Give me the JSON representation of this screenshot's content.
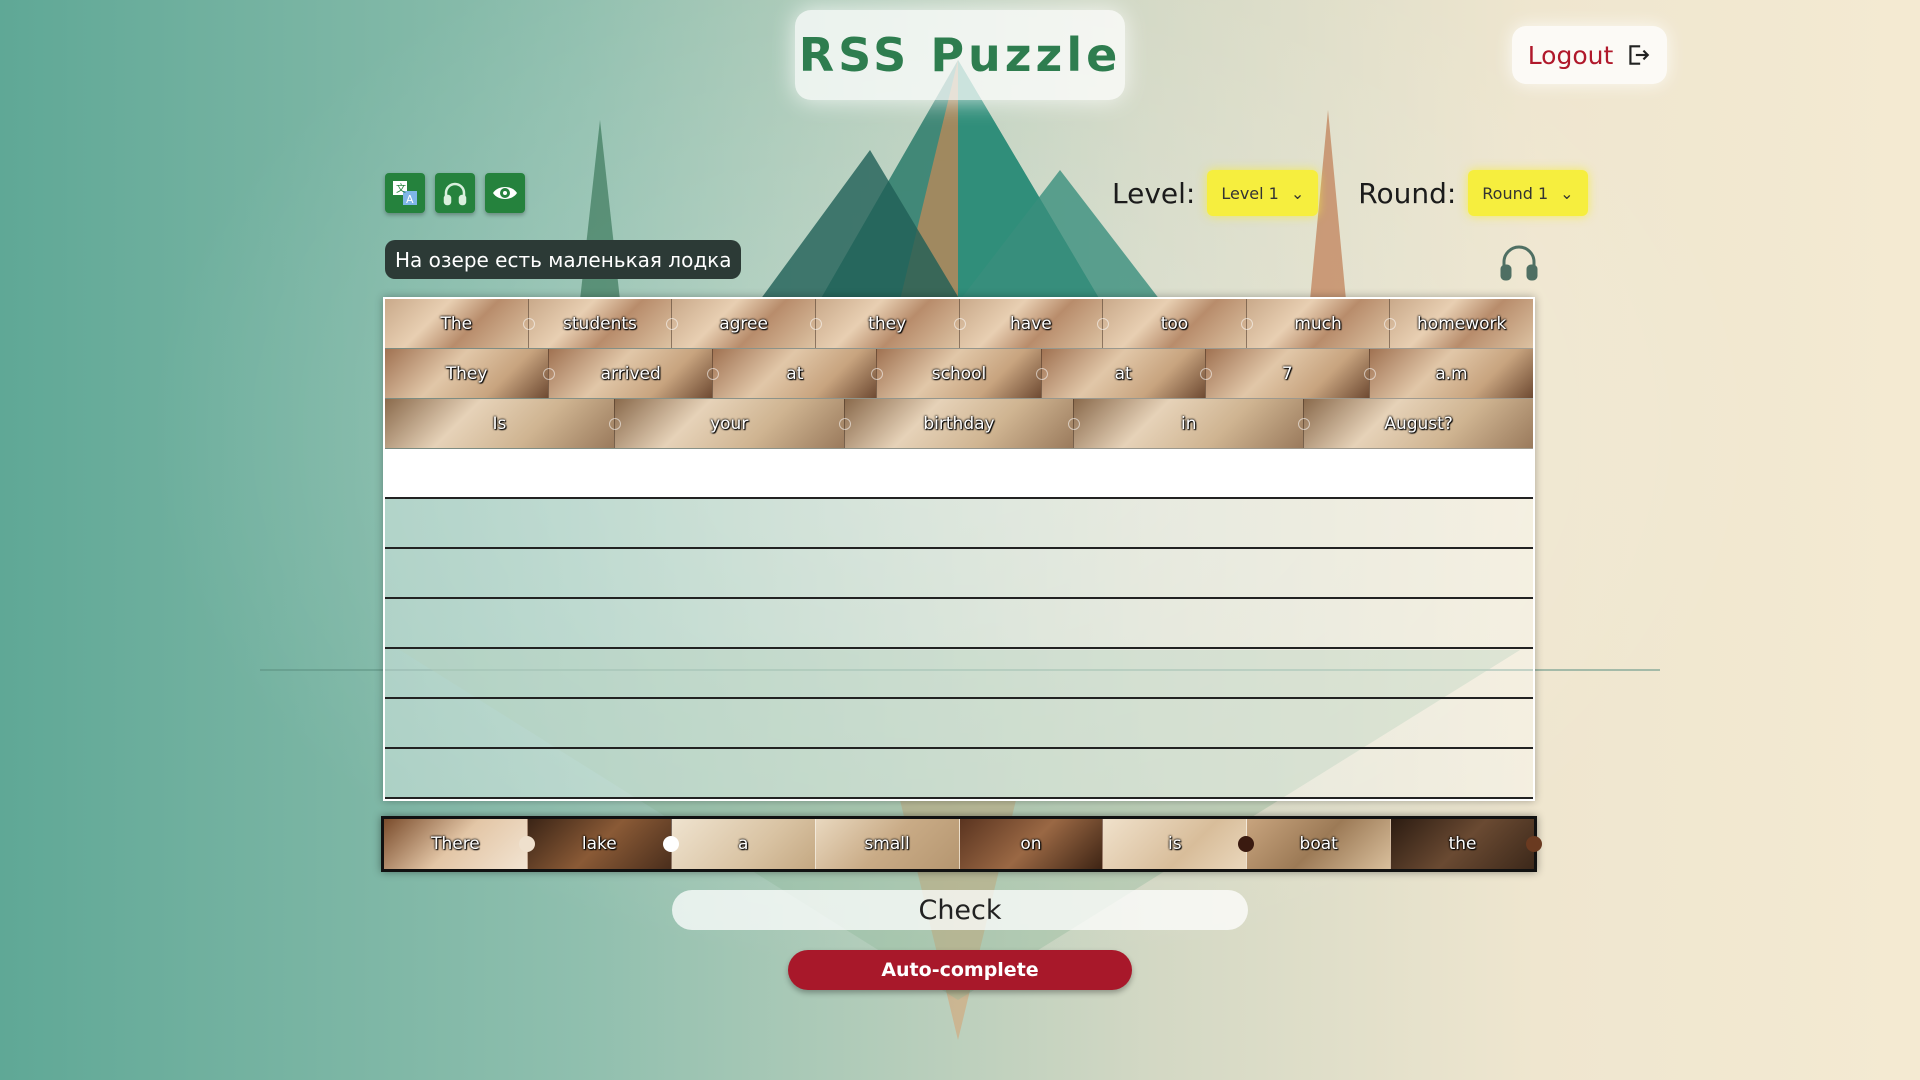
{
  "app": {
    "title": "RSS Puzzle"
  },
  "header": {
    "logout_label": "Logout"
  },
  "toolbar": {
    "buttons": [
      {
        "icon": "translate-icon"
      },
      {
        "icon": "headphones-icon"
      },
      {
        "icon": "eye-icon"
      }
    ]
  },
  "level": {
    "label": "Level:",
    "value": "Level 1"
  },
  "round": {
    "label": "Round:",
    "value": "Round 1"
  },
  "hint": {
    "translation": "На озере есть маленькая лодка"
  },
  "board": {
    "completed_rows": [
      [
        "The",
        "students",
        "agree",
        "they",
        "have",
        "too",
        "much",
        "homework"
      ],
      [
        "They",
        "arrived",
        "at",
        "school",
        "at",
        "7",
        "a.m"
      ],
      [
        "Is",
        "your",
        "birthday",
        "in",
        "August?"
      ]
    ],
    "empty_rows": 7
  },
  "source": {
    "pieces": [
      "There",
      "lake",
      "a",
      "small",
      "on",
      "is",
      "boat",
      "the"
    ]
  },
  "actions": {
    "check_label": "Check",
    "autocomplete_label": "Auto-complete"
  },
  "colors": {
    "accent": "#25823d",
    "title": "#2e7d4f",
    "logout": "#b0182b",
    "select": "#f6ee3e",
    "autocomplete": "#a8182a"
  }
}
